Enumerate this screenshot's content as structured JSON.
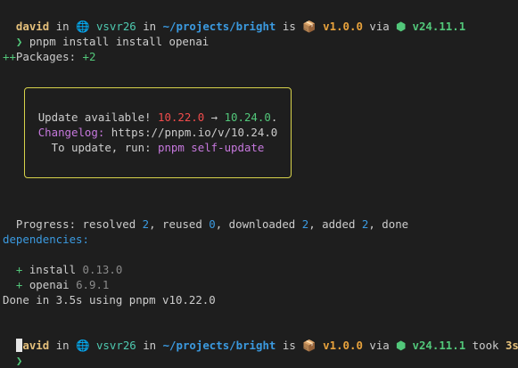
{
  "prompt1": {
    "user": "david",
    "in1": " in ",
    "globe_icon": "🌐",
    "host": " vsvr26",
    "in2": " in ",
    "path": "~/projects/bright",
    "is": " is ",
    "package_icon": "📦",
    "version": " v1.0.0",
    "via": " via ",
    "node_icon": "⬢",
    "node_version": " v24.11.1"
  },
  "command": {
    "arrow": "❯",
    "text": " pnpm install install openai"
  },
  "packages": {
    "label": "Packages: ",
    "value": "+2"
  },
  "plus_line": "++",
  "update_box": {
    "line1_prefix": "Update available! ",
    "old_version": "10.22.0",
    "arrow": " → ",
    "new_version": "10.24.0",
    "line1_suffix": ".",
    "changelog_label": "Changelog:",
    "changelog_url": " https://pnpm.io/v/10.24.0",
    "update_prefix": "To update, run: ",
    "update_cmd": "pnpm self-update"
  },
  "progress": {
    "p1": "Progress: resolved ",
    "resolved": "2",
    "p2": ", reused ",
    "reused": "0",
    "p3": ", downloaded ",
    "downloaded": "2",
    "p4": ", added ",
    "added": "2",
    "p5": ", done"
  },
  "dependencies": {
    "header": "dependencies:",
    "items": [
      {
        "plus": "+",
        "name": " install ",
        "version": "0.13.0"
      },
      {
        "plus": "+",
        "name": " openai ",
        "version": "6.9.1"
      }
    ]
  },
  "done_line": "Done in 3.5s using pnpm v10.22.0",
  "prompt2": {
    "user": "david",
    "in1": " in ",
    "globe_icon": "🌐",
    "host": " vsvr26",
    "in2": " in ",
    "path": "~/projects/bright",
    "is": " is ",
    "package_icon": "📦",
    "version": " v1.0.0",
    "via": " via ",
    "node_icon": "⬢",
    "node_version": " v24.11.1",
    "took": " took ",
    "duration": "3s"
  },
  "prompt3": {
    "arrow": "❯"
  }
}
